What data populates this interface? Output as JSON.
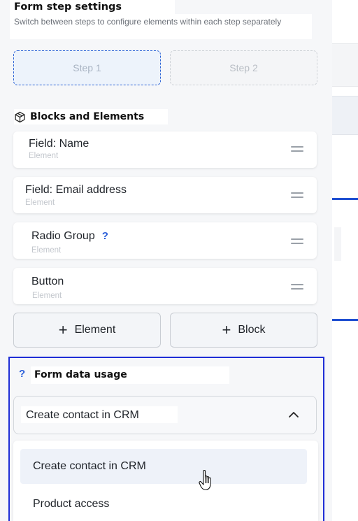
{
  "header": {
    "title": "Form step settings",
    "subtitle": "Switch between steps to configure elements within each step separately"
  },
  "steps": [
    {
      "label": "Step 1",
      "active": true
    },
    {
      "label": "Step 2",
      "active": false
    }
  ],
  "blocks_section": {
    "title": "Blocks and Elements",
    "icon": "cube-icon",
    "items": [
      {
        "label": "Field: Name",
        "type": "Element",
        "has_help": false
      },
      {
        "label": "Field: Email address",
        "type": "Element",
        "has_help": false
      },
      {
        "label": "Radio Group",
        "type": "Element",
        "has_help": true,
        "help": "?"
      },
      {
        "label": "Button",
        "type": "Element",
        "has_help": false
      }
    ],
    "add_element_label": "Element",
    "add_block_label": "Block",
    "plus_symbol": "+"
  },
  "usage": {
    "help": "?",
    "title": "Form data usage",
    "selected": "Create contact in CRM",
    "options": [
      "Create contact in CRM",
      "Product access"
    ]
  },
  "colors": {
    "accent": "#2b5fd9",
    "focus_outline": "#1f2ed6",
    "panel_bg": "#f6f7f9"
  }
}
